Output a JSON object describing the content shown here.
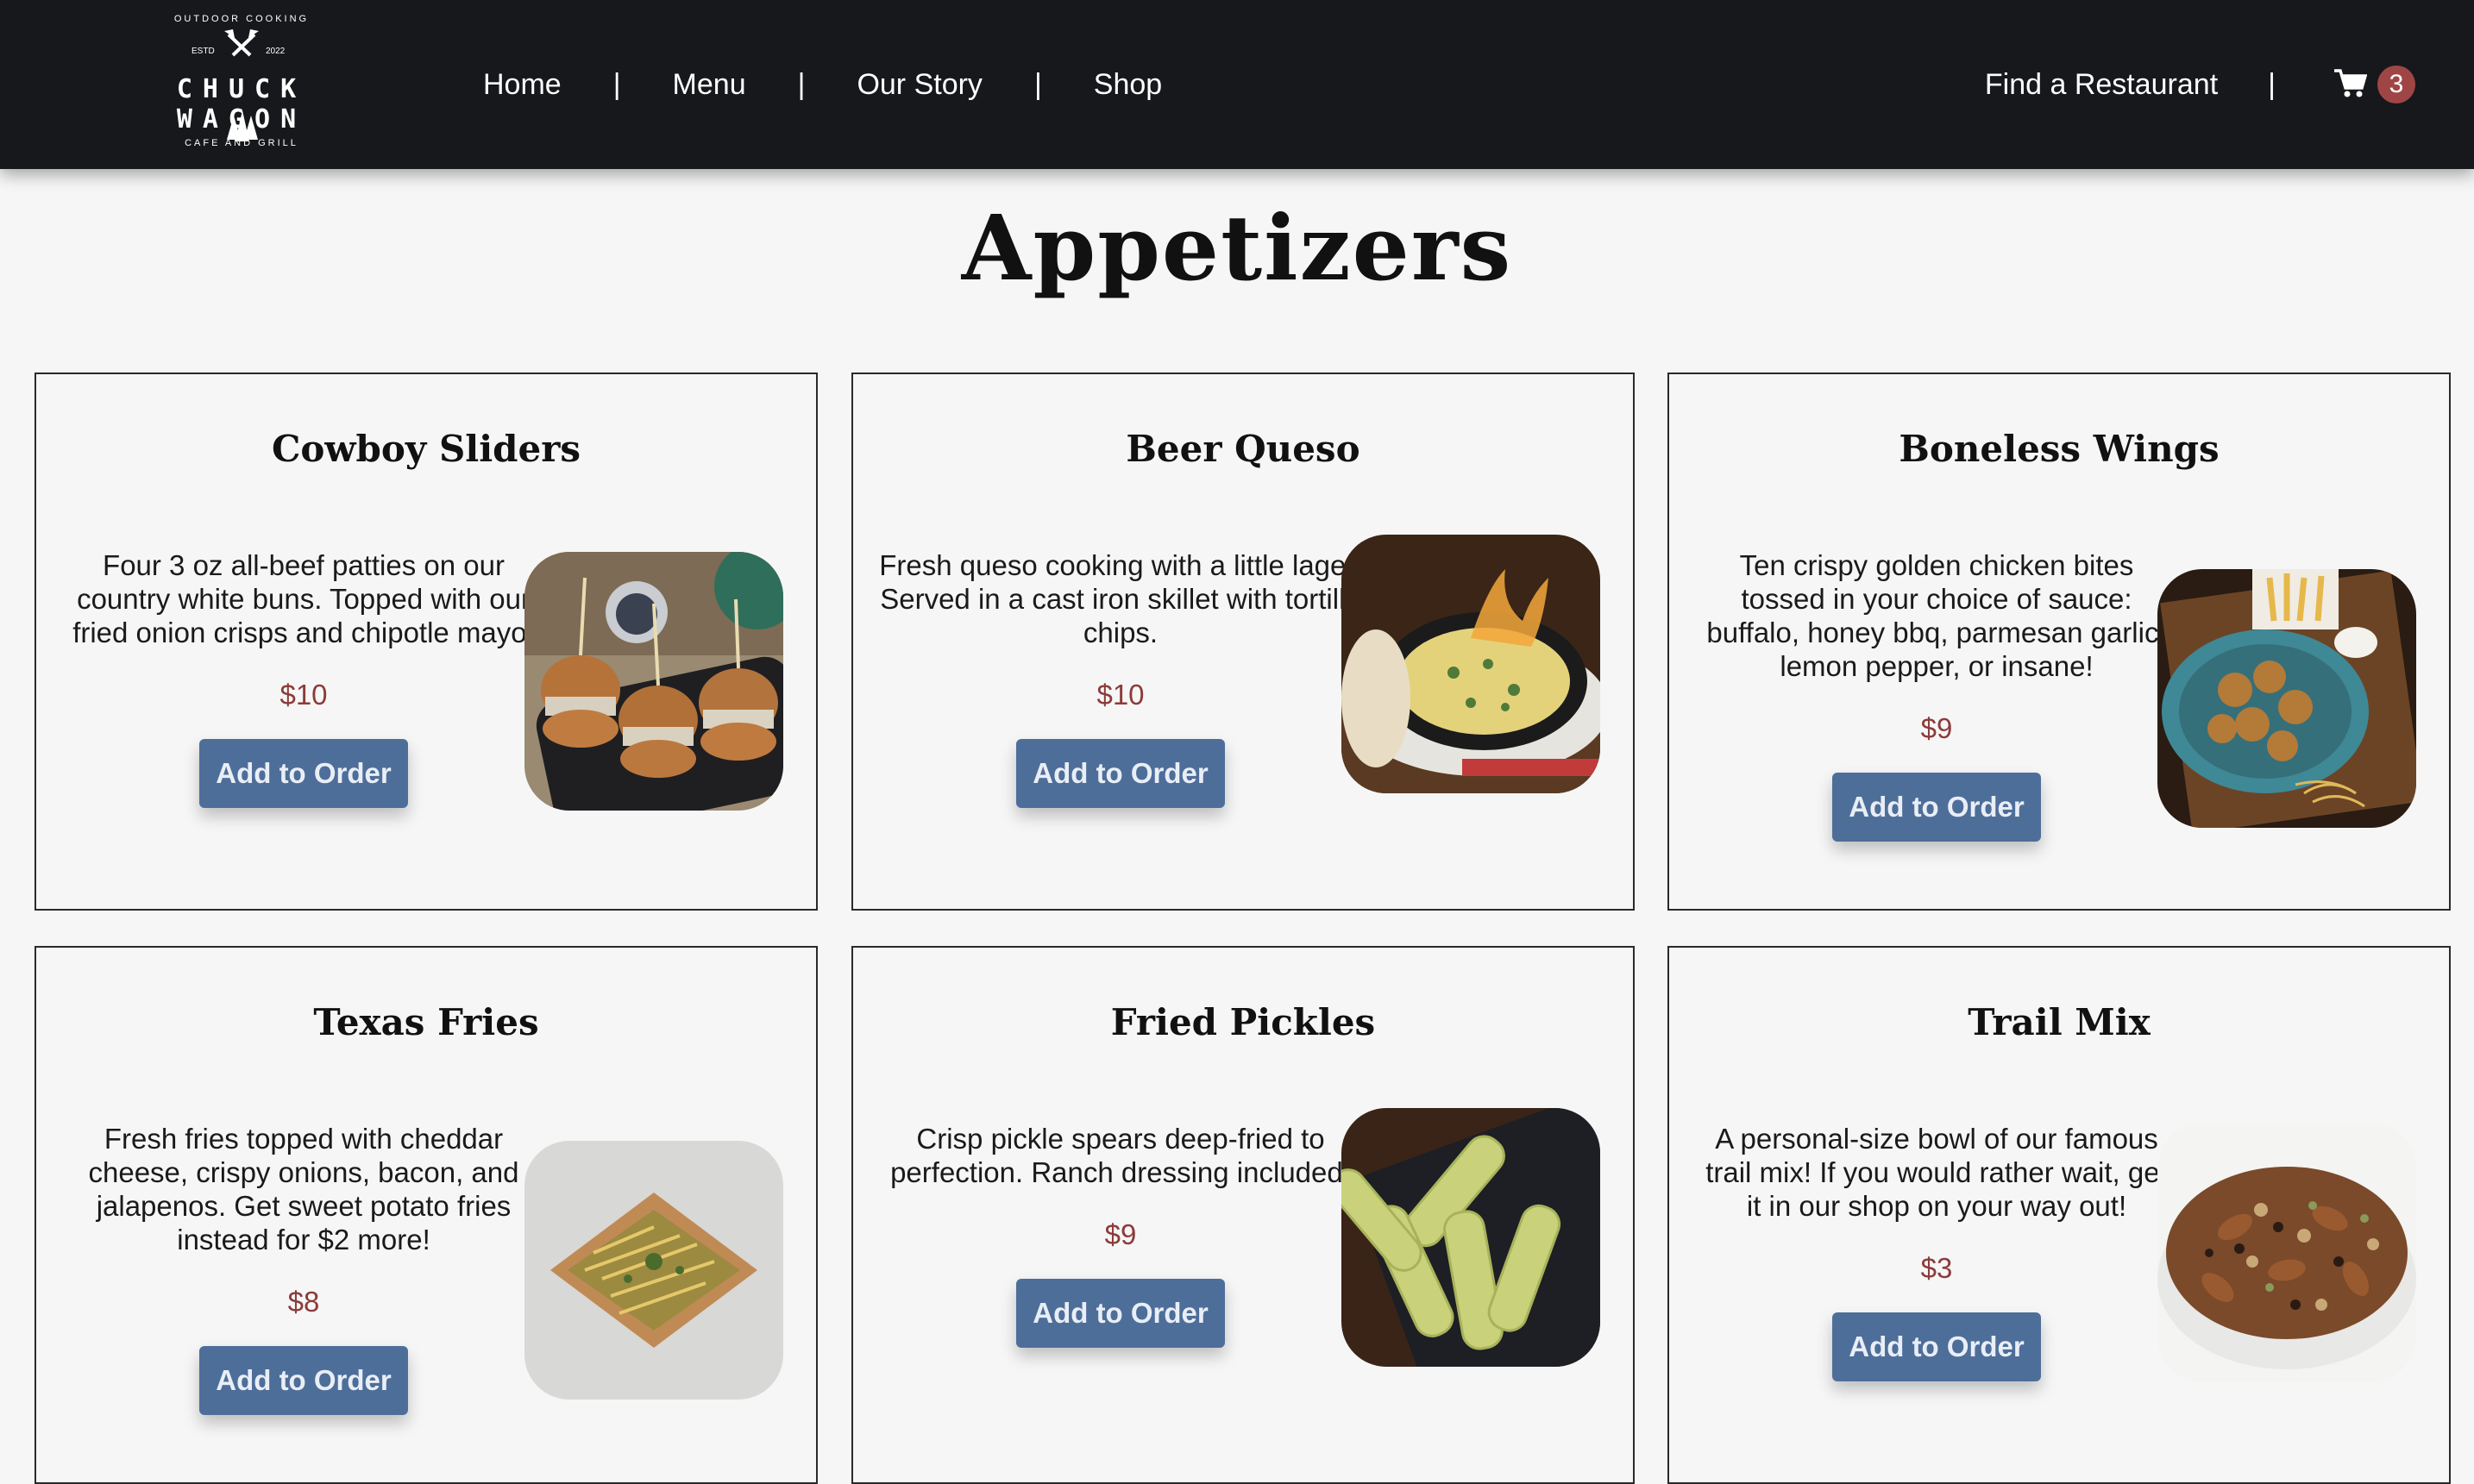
{
  "header": {
    "logo": {
      "top_arc": "OUTDOOR COOKING",
      "estd": "ESTD",
      "year": "2022",
      "title": "CHUCK WAGON",
      "bottom_arc": "CAFE AND GRILL"
    },
    "nav": [
      "Home",
      "Menu",
      "Our Story",
      "Shop"
    ],
    "separator": "|",
    "find_restaurant": "Find a Restaurant",
    "cart_count": "3"
  },
  "page_title": "Appetizers",
  "button_label": "Add to Order",
  "items": [
    {
      "title": "Cowboy Sliders",
      "desc": "Four 3 oz all-beef patties on our country white buns. Topped with our fried onion crisps and chipotle mayo.",
      "price": "$10",
      "image": "sliders-photo"
    },
    {
      "title": "Beer Queso",
      "desc": "Fresh queso cooking with a little lager. Served in a cast iron skillet with tortilla chips.",
      "price": "$10",
      "image": "queso-photo"
    },
    {
      "title": "Boneless Wings",
      "desc": "Ten crispy golden chicken bites tossed in your choice of sauce: buffalo, honey bbq, parmesan garlic, lemon pepper, or insane!",
      "price": "$9",
      "image": "wings-photo"
    },
    {
      "title": "Texas Fries",
      "desc": "Fresh fries topped with cheddar cheese, crispy onions, bacon, and jalapenos. Get sweet potato fries instead for $2 more!",
      "price": "$8",
      "image": "fries-photo"
    },
    {
      "title": "Fried Pickles",
      "desc": "Crisp pickle spears deep-fried to perfection. Ranch dressing included.",
      "price": "$9",
      "image": "pickles-photo"
    },
    {
      "title": "Trail Mix",
      "desc": "A personal-size bowl of our famous trail mix! If you would rather wait, get it in our shop on your way out!",
      "price": "$3",
      "image": "trailmix-photo"
    }
  ]
}
